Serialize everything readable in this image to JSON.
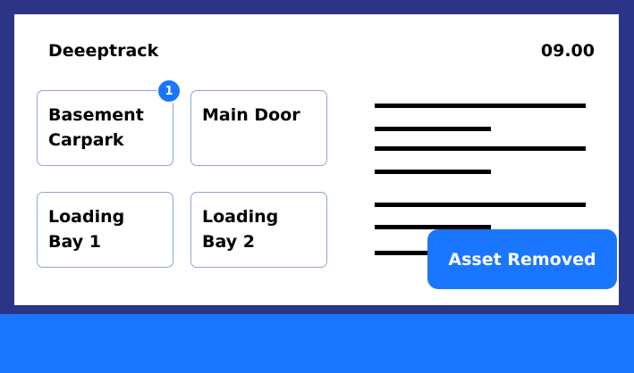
{
  "app": {
    "title": "Deeeptrack",
    "time": "09.00"
  },
  "zones": [
    {
      "label": "Basement\nCarpark",
      "badge": "1"
    },
    {
      "label": "Main Door"
    },
    {
      "label": "Loading\nBay 1"
    },
    {
      "label": "Loading\nBay 2"
    }
  ],
  "toast": {
    "message": "Asset Removed"
  },
  "colors": {
    "frame": "#2b3486",
    "accent": "#1a76ff",
    "tile_border": "#8fa6d0"
  }
}
